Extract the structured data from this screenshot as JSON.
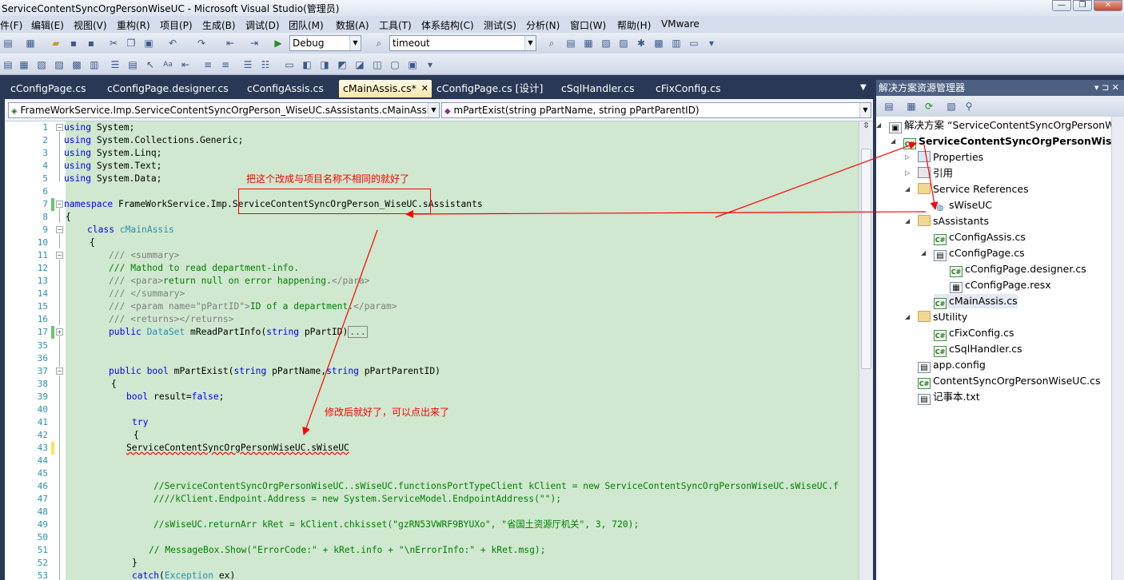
{
  "window": {
    "title": "ServiceContentSyncOrgPersonWiseUC - Microsoft Visual Studio(管理员)",
    "minimize": "—",
    "restore": "❐",
    "close": "✕"
  },
  "menu": [
    "件(F)",
    "编辑(E)",
    "视图(V)",
    "重构(R)",
    "项目(P)",
    "生成(B)",
    "调试(D)",
    "团队(M)",
    "数据(A)",
    "工具(T)",
    "体系结构(C)",
    "测试(S)",
    "分析(N)",
    "窗口(W)",
    "帮助(H)",
    "VMware"
  ],
  "toolbar": {
    "config": "Debug",
    "find": "timeout"
  },
  "tabs": [
    "cConfigPage.cs",
    "cConfigPage.designer.cs",
    "cConfigAssis.cs",
    "cMainAssis.cs*",
    "cConfigPage.cs [设计]",
    "cSqlHandler.cs",
    "cFixConfig.cs"
  ],
  "tab_close": "✕",
  "tab_menu": "▼",
  "navbar": {
    "type_scope": "FrameWorkService.Imp.ServiceContentSyncOrgPerson_WiseUC.sAssistants.cMainAssis",
    "member_scope": "mPartExist(string pPartName, string pPartParentID)"
  },
  "code": {
    "line_numbers": [
      "1",
      "2",
      "3",
      "4",
      "5",
      "6",
      "7",
      "8",
      "9",
      "10",
      "11",
      "12",
      "13",
      "14",
      "15",
      "16",
      "17",
      "35",
      "36",
      "37",
      "38",
      "39",
      "40",
      "41",
      "42",
      "43",
      "44",
      "45",
      "46",
      "47",
      "48",
      "49",
      "50",
      "51",
      "52",
      "53"
    ],
    "l1_kw": "using",
    "l1_rest": " System;",
    "l2_kw": "using",
    "l2_rest": " System.Collections.Generic;",
    "l3_kw": "using",
    "l3_rest": " System.Linq;",
    "l4_kw": "using",
    "l4_rest": " System.Text;",
    "l5_kw": "using",
    "l5_rest": " System.Data;",
    "l7_kw": "namespace",
    "l7_rest": " FrameWorkService.Imp.ServiceContentSyncOrgPerson_WiseUC.sAssistants",
    "l8": "{",
    "l9_kw": "class",
    "l9_type": "cMainAssis",
    "l10": "{",
    "l11_pre": "/// ",
    "l11_tag": "<summary>",
    "l12": "/// Mathod to read department-info.",
    "l13_pre": "/// ",
    "l13_tag1": "<para>",
    "l13_mid": "return null on error happening.",
    "l13_tag2": "</para>",
    "l14_pre": "/// ",
    "l14_tag": "</summary>",
    "l15_pre": "/// ",
    "l15_tag1": "<param name=\"pPartID\">",
    "l15_mid": "ID of a department.",
    "l15_tag2": "</param>",
    "l16_pre": "/// ",
    "l16_tag": "<returns></returns>",
    "l17_kw": "public",
    "l17_type": "DataSet",
    "l17_mid": " mReadPartInfo(",
    "l17_kw2": "string",
    "l17_end": " pPartID)",
    "l17_collapsed": "...",
    "l37_kw1": "public",
    "l37_kw2": "bool",
    "l37_mid": " mPartExist(",
    "l37_kw3": "string",
    "l37_mid2": " pPartName,",
    "l37_kw4": "string",
    "l37_end": " pPartParentID)",
    "l38": "{",
    "l39_kw": "bool",
    "l39_mid": " result=",
    "l39_kw2": "false",
    "l39_end": ";",
    "l41_kw": "try",
    "l42": "{",
    "l43": "ServiceContentSyncOrgPersonWiseUC.sWiseUC",
    "l46": "//ServiceContentSyncOrgPersonWiseUC..sWiseUC.functionsPortTypeClient kClient = new ServiceContentSyncOrgPersonWiseUC.sWiseUC.f",
    "l47": "////kClient.Endpoint.Address = new System.ServiceModel.EndpointAddress(\"\");",
    "l49": "//sWiseUC.returnArr kRet = kClient.chkisset(\"gzRN53VWRF9BYUXo\", \"省国土资源厅机关\", 3, 720);",
    "l51": "// MessageBox.Show(\"ErrorCode:\" + kRet.info + \"\\nErrorInfo:\" + kRet.msg);",
    "l52": "}",
    "l53_kw": "catch",
    "l53_mid": "(",
    "l53_type": "Exception",
    "l53_end": " ex)"
  },
  "annotations": {
    "top": "把这个改成与项目名称不相同的就好了",
    "bottom": "修改后就好了，可以点出来了"
  },
  "solution": {
    "title": "解决方案资源管理器",
    "pin": "▾ ⊐ ✕",
    "root": "解决方案 “ServiceContentSyncOrgPersonWise",
    "project": "ServiceContentSyncOrgPersonWiseUC",
    "items": {
      "properties": "Properties",
      "references": "引用",
      "service_refs": "Service References",
      "swiseuc": "sWiseUC",
      "sassistants": "sAssistants",
      "cconfigassis": "cConfigAssis.cs",
      "cconfigpage": "cConfigPage.cs",
      "cconfigpage_designer": "cConfigPage.designer.cs",
      "cconfigpage_resx": "cConfigPage.resx",
      "cmainassis": "cMainAssis.cs",
      "sutility": "sUtility",
      "cfixconfig": "cFixConfig.cs",
      "csqlhandler": "cSqlHandler.cs",
      "appconfig": "app.config",
      "contentsync": "ContentSyncOrgPersonWiseUC.cs",
      "notepad": "记事本.txt"
    }
  },
  "colors": {
    "annotation": "#ff0000",
    "code_bg": "#cfe8cf",
    "keyword": "#0000ff",
    "type": "#2b91af",
    "comment": "#008000"
  }
}
